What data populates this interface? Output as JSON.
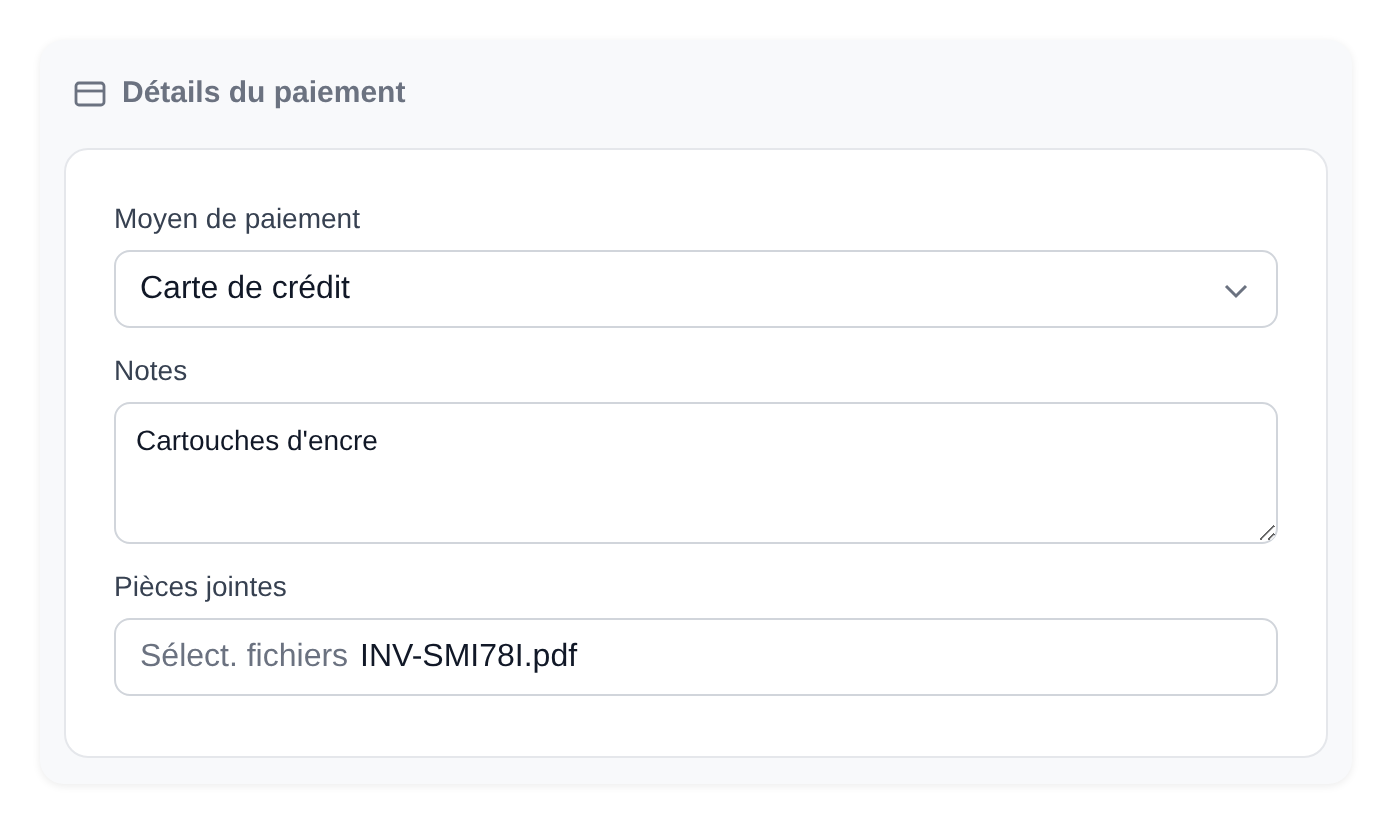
{
  "panel": {
    "title": "Détails du paiement"
  },
  "fields": [
    {
      "kind": "select",
      "label": "Moyen de paiement",
      "value": "Carte de crédit"
    },
    {
      "kind": "textarea",
      "label": "Notes",
      "value": "Cartouches d'encre"
    },
    {
      "kind": "file",
      "label": "Pièces jointes",
      "button": "Sélect. fichiers",
      "value": "INV-SMI78I.pdf"
    }
  ]
}
